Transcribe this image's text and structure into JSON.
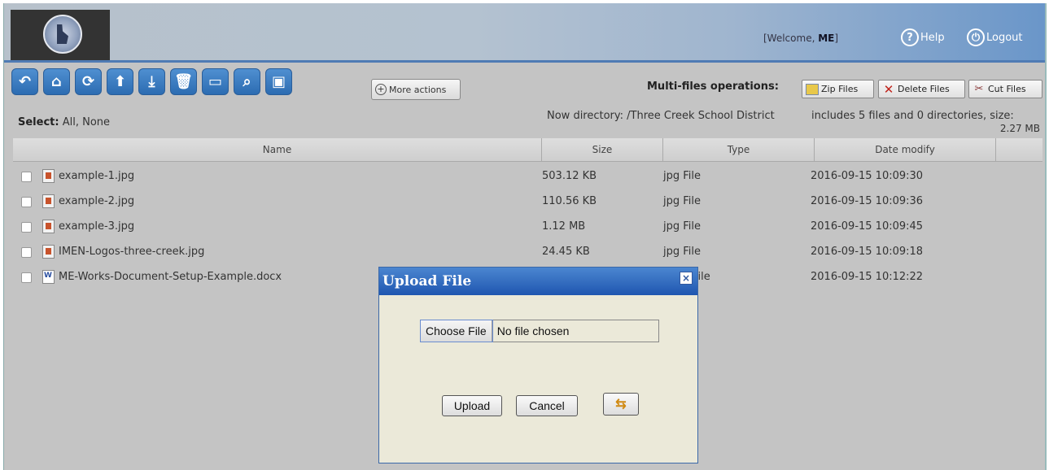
{
  "header": {
    "welcome_prefix": "[Welcome, ",
    "welcome_user": "ME",
    "welcome_suffix": "]",
    "help_label": "Help",
    "logout_label": "Logout"
  },
  "toolbar": {
    "more_actions_label": "More actions",
    "icons": [
      "back-icon",
      "home-icon",
      "refresh-icon",
      "up-icon",
      "download-icon",
      "trash-icon",
      "folder-icon",
      "search-icon",
      "image-icon"
    ]
  },
  "selection": {
    "label": "Select:",
    "all": "All",
    "sep": ",",
    "none": "None"
  },
  "multi_ops": {
    "label": "Multi-files operations:",
    "zip_label": "Zip Files",
    "delete_label": "Delete Files",
    "cut_label": "Cut Files"
  },
  "directory": {
    "now_directory": "Now directory: /Three Creek School District",
    "includes": "includes 5 files and 0 directories, size:",
    "size": "2.27 MB"
  },
  "table": {
    "columns": [
      "Name",
      "Size",
      "Type",
      "Date modify"
    ],
    "rows": [
      {
        "name": "example-1.jpg",
        "size": "503.12 KB",
        "type": "jpg File",
        "date": "2016-09-15 10:09:30",
        "icon": "image-file-icon"
      },
      {
        "name": "example-2.jpg",
        "size": "110.56 KB",
        "type": "jpg File",
        "date": "2016-09-15 10:09:36",
        "icon": "image-file-icon"
      },
      {
        "name": "example-3.jpg",
        "size": "1.12 MB",
        "type": "jpg File",
        "date": "2016-09-15 10:09:45",
        "icon": "image-file-icon"
      },
      {
        "name": "IMEN-Logos-three-creek.jpg",
        "size": "24.45 KB",
        "type": "jpg File",
        "date": "2016-09-15 10:09:18",
        "icon": "image-file-icon"
      },
      {
        "name": "ME-Works-Document-Setup-Example.docx",
        "size": "",
        "type": "File",
        "date": "2016-09-15 10:12:22",
        "icon": "word-doc-icon"
      }
    ]
  },
  "dialog": {
    "title": "Upload File",
    "close_glyph": "×",
    "choose_file_label": "Choose File",
    "no_file_text": "No file chosen",
    "upload_label": "Upload",
    "cancel_label": "Cancel",
    "swap_glyph": "⇆"
  },
  "colors": {
    "header_blue": "#6a96c9",
    "toolbar_blue": "#2c6cb2",
    "dialog_title": "#1f56b0",
    "dialog_body": "#ebe9d9"
  }
}
